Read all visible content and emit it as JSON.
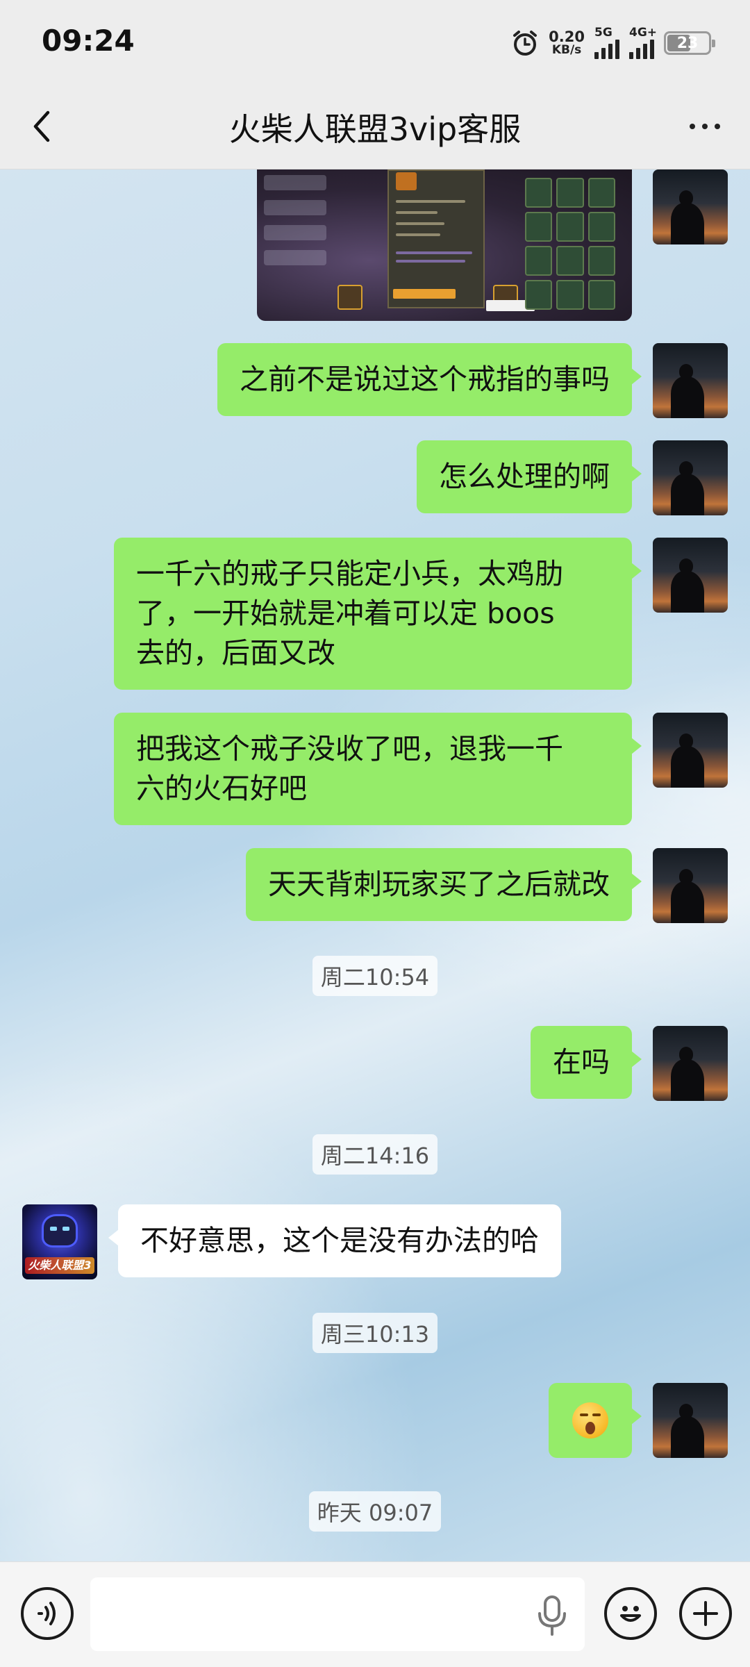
{
  "status_bar": {
    "time": "09:24",
    "net_speed_value": "0.20",
    "net_speed_unit": "KB/s",
    "signal1_label": "5G",
    "signal2_label": "4G+",
    "battery_level": "23"
  },
  "header": {
    "title": "火柴人联盟3vip客服",
    "back_icon": "chevron-left-icon",
    "more_icon": "more-dots-icon"
  },
  "messages": [
    {
      "type": "image",
      "sender": "me",
      "image_desc": "game-screenshot"
    },
    {
      "type": "text",
      "sender": "me",
      "text": "之前不是说过这个戒指的事吗"
    },
    {
      "type": "text",
      "sender": "me",
      "text": "怎么处理的啊"
    },
    {
      "type": "text",
      "sender": "me",
      "lines": [
        "一千六的戒子只能定小兵，太鸡肋",
        "了，一开始就是冲着可以定 boos",
        "去的，后面又改"
      ]
    },
    {
      "type": "text",
      "sender": "me",
      "lines": [
        "把我这个戒子没收了吧，退我一千",
        "六的火石好吧"
      ]
    },
    {
      "type": "text",
      "sender": "me",
      "text": "天天背刺玩家买了之后就改"
    },
    {
      "type": "time",
      "text": "周二10:54"
    },
    {
      "type": "text",
      "sender": "me",
      "text": "在吗"
    },
    {
      "type": "time",
      "text": "周二14:16"
    },
    {
      "type": "text",
      "sender": "them",
      "text": "不好意思，这个是没有办法的哈"
    },
    {
      "type": "time",
      "text": "周三10:13"
    },
    {
      "type": "emoji",
      "sender": "me",
      "emoji": "shocked-face-emoji"
    },
    {
      "type": "time",
      "text": "昨天 09:07"
    }
  ],
  "contact_avatar_logo": "火柴人联盟3",
  "input_bar": {
    "voice_icon": "voice-toggle-icon",
    "mic_icon": "microphone-icon",
    "emoji_icon": "emoji-icon",
    "plus_icon": "plus-icon",
    "value": "",
    "placeholder": ""
  },
  "colors": {
    "my_bubble": "#95ec69",
    "their_bubble": "#ffffff",
    "bar_bg": "#ededed"
  }
}
